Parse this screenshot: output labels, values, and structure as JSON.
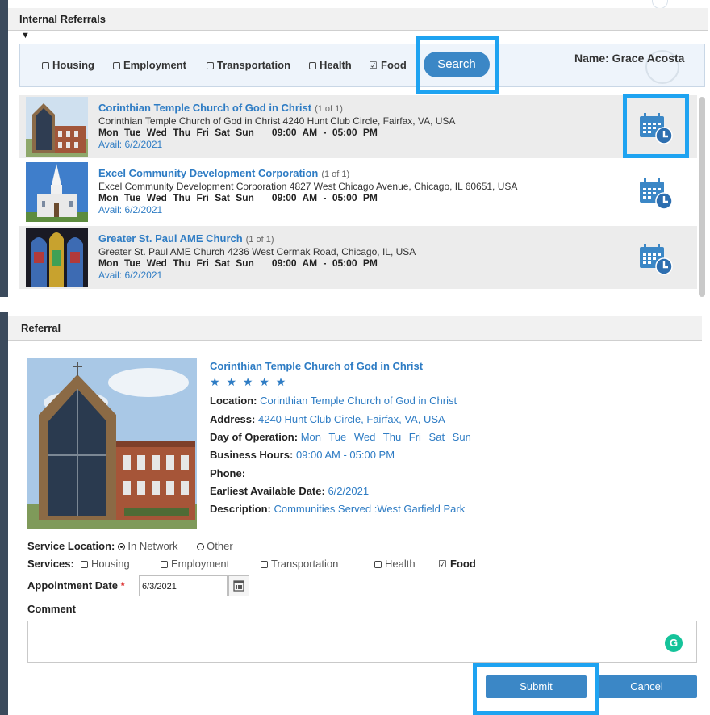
{
  "internal_referrals": {
    "header": "Internal Referrals",
    "filters": [
      {
        "label": "Housing",
        "checked": false
      },
      {
        "label": "Employment",
        "checked": false
      },
      {
        "label": "Transportation",
        "checked": false
      },
      {
        "label": "Health",
        "checked": false
      },
      {
        "label": "Food",
        "checked": true
      }
    ],
    "search_label": "Search",
    "name_label": "Name: Grace Acosta",
    "results": [
      {
        "title": "Corinthian Temple Church of God in Christ",
        "count": "(1 of 1)",
        "address": "Corinthian Temple Church of God in Christ   4240 Hunt Club Circle, Fairfax, VA, USA",
        "days": "Mon Tue Wed Thu Fri Sat Sun",
        "hours": "09:00 AM - 05:00 PM",
        "avail": "Avail: 6/2/2021"
      },
      {
        "title": "Excel Community Development Corporation",
        "count": "(1 of 1)",
        "address": "Excel Community Development Corporation   4827 West Chicago Avenue, Chicago, IL 60651, USA",
        "days": "Mon Tue Wed Thu Fri Sat Sun",
        "hours": "09:00 AM - 05:00 PM",
        "avail": "Avail: 6/2/2021"
      },
      {
        "title": "Greater St. Paul AME Church",
        "count": "(1 of 1)",
        "address": "Greater St. Paul AME Church   4236 West Cermak Road, Chicago, IL, USA",
        "days": "Mon Tue Wed Thu Fri Sat Sun",
        "hours": "09:00 AM - 05:00 PM",
        "avail": "Avail: 6/2/2021"
      }
    ]
  },
  "referral": {
    "header": "Referral",
    "title": "Corinthian Temple Church of God in Christ",
    "stars": "★ ★ ★ ★ ★",
    "location_label": "Location:",
    "location": "Corinthian Temple Church of God in Christ",
    "address_label": "Address:",
    "address": "4240 Hunt Club Circle, Fairfax, VA, USA",
    "days_label": "Day of Operation:",
    "days": "Mon Tue Wed Thu Fri Sat Sun",
    "hours_label": "Business Hours:",
    "hours": "09:00 AM - 05:00 PM",
    "phone_label": "Phone:",
    "earliest_label": "Earliest Available Date:",
    "earliest": "6/2/2021",
    "description_label": "Description:",
    "description": "Communities Served :West Garfield Park",
    "service_location_label": "Service Location:",
    "service_location_options": [
      {
        "label": "In Network",
        "selected": true
      },
      {
        "label": "Other",
        "selected": false
      }
    ],
    "services_label": "Services:",
    "services": [
      {
        "label": "Housing",
        "checked": false
      },
      {
        "label": "Employment",
        "checked": false
      },
      {
        "label": "Transportation",
        "checked": false
      },
      {
        "label": "Health",
        "checked": false
      },
      {
        "label": "Food",
        "checked": true
      }
    ],
    "appointment_label": "Appointment Date",
    "required_mark": "*",
    "appointment_value": "6/3/2021",
    "comment_label": "Comment",
    "grammarly": "G",
    "submit_label": "Submit",
    "cancel_label": "Cancel"
  },
  "colors": {
    "accent": "#3b87c6",
    "link": "#2e7cc4",
    "highlight": "#1ea3f1",
    "sidebar": "#3b4a5c"
  }
}
